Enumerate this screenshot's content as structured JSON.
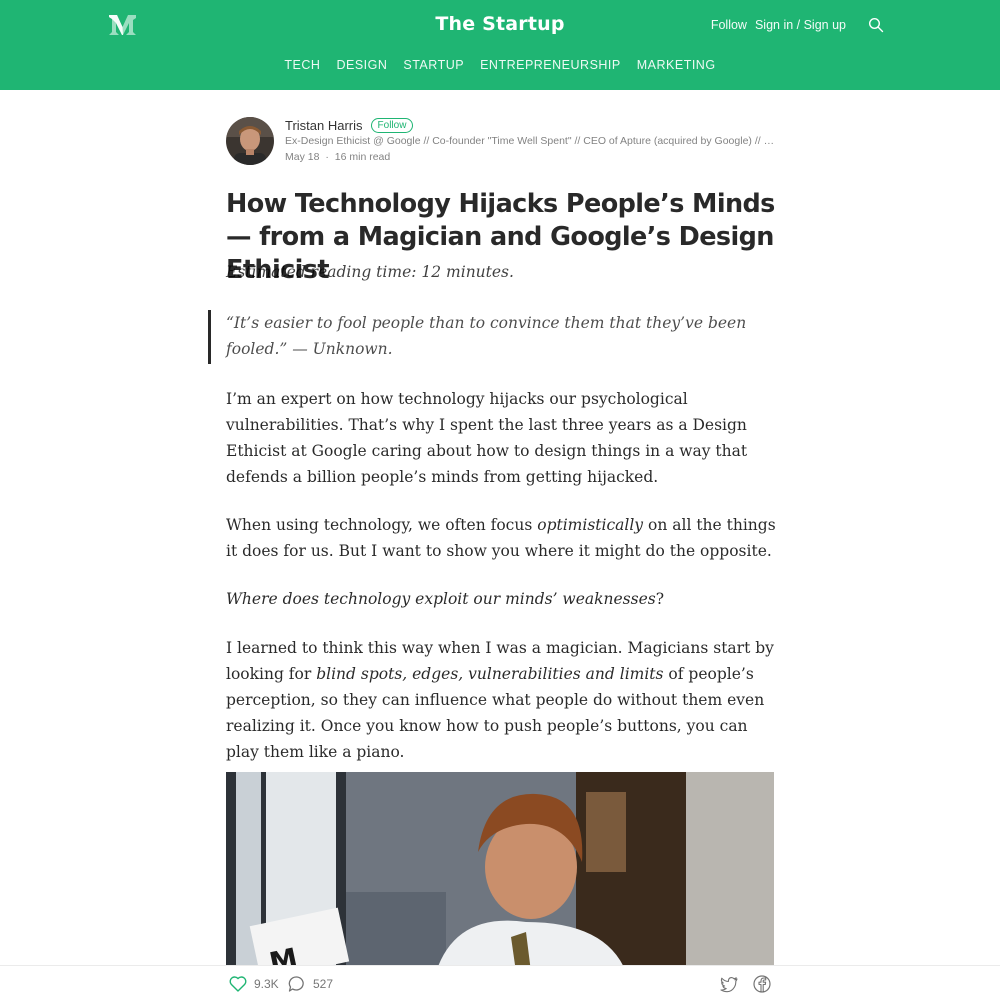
{
  "header": {
    "publication": "The Startup",
    "follow_label": "Follow",
    "signin_label": "Sign in / Sign up",
    "brand_color": "#1fb573",
    "nav": [
      "TECH",
      "DESIGN",
      "STARTUP",
      "ENTREPRENEURSHIP",
      "MARKETING"
    ]
  },
  "author": {
    "name": "Tristan Harris",
    "follow_label": "Follow",
    "bio": "Ex-Design Ethicist @ Google // Co-founder \"Time Well Spent\" // CEO of Apture (acquired by Google) // Phi...",
    "date": "May 18",
    "separator": "·",
    "read_time": "16 min read"
  },
  "article": {
    "title": "How Technology Hijacks People’s Minds — from a Magician and Google’s Design Ethicist",
    "subtitle": "Estimated reading time: 12 minutes.",
    "quote": "“It’s easier to fool people than to convince them that they’ve been fooled.” — Unknown.",
    "p1": "I’m an expert on how technology hijacks our psychological vulnerabilities. That’s why I spent the last three years as a Design Ethicist at Google caring about how to design things in a way that defends a billion people’s minds from getting hijacked.",
    "p2_a": "When using technology, we often focus ",
    "p2_em": "optimistically",
    "p2_b": " on all the things it does for us. But I want to show you where it might do the opposite.",
    "p3_em": "Where does technology exploit our minds’ weaknesses",
    "p3_b": "?",
    "p4_a": "I learned to think this way when I was a magician. Magicians start by looking for ",
    "p4_em": "blind spots, edges, vulnerabilities and limits",
    "p4_b": " of people’s perception, so they can influence what people do without them even realizing it. Once you know how to push people’s buttons, you can play them like a piano."
  },
  "footer": {
    "likes": "9.3K",
    "comments": "527"
  }
}
